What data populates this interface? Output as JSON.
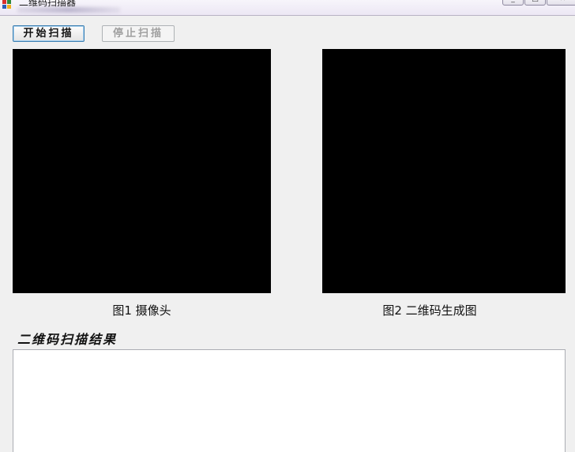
{
  "window": {
    "title": "二维码扫描器",
    "controls": {
      "minimize_glyph": "_",
      "maximize_glyph": "□",
      "close_glyph": "✕"
    },
    "icon": "app-icon"
  },
  "toolbar": {
    "start_label": "开始扫描",
    "stop_label": "停止扫描",
    "stop_enabled": false
  },
  "panels": {
    "camera_caption": "图1 摄像头",
    "qr_caption": "图2 二维码生成图",
    "background": "#000000"
  },
  "result": {
    "label": "二维码扫描结果",
    "value": ""
  },
  "colors": {
    "window_bg": "#f0f0f0",
    "start_button_border": "#3c7fb1",
    "disabled_text": "#a0a0a0"
  }
}
